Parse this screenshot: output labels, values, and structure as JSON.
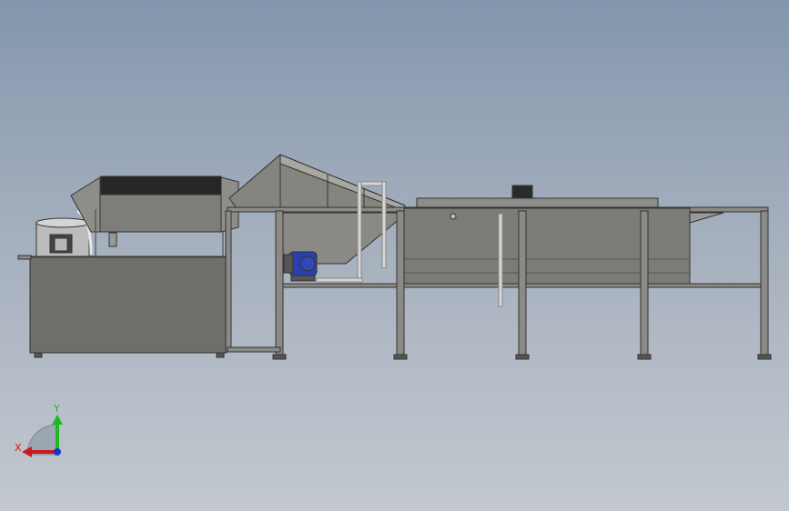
{
  "viewport": {
    "background_top": "#8496ad",
    "background_bottom": "#c3c8cf"
  },
  "model": {
    "frame_color": "#7b7b78",
    "frame_edge_color": "#333333",
    "belt_color": "#262626",
    "motor_color": "#2c3fae",
    "pipe_color": "#d6d6d6"
  },
  "triad": {
    "y_label": "Y",
    "x_label": "X",
    "y_color": "#1fb81f",
    "x_color": "#cc1a1a",
    "origin_color": "#1c33c8"
  }
}
